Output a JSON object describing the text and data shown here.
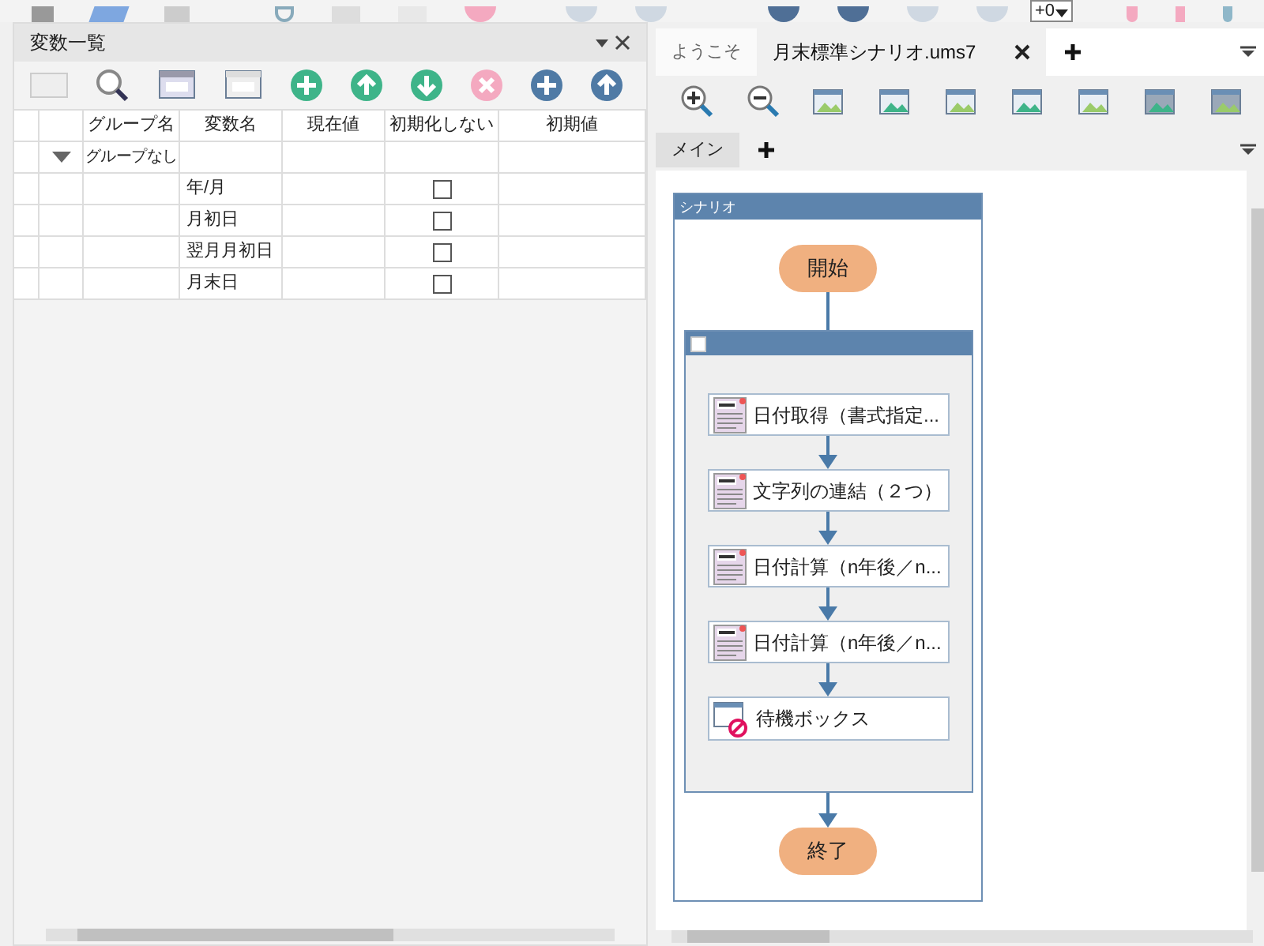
{
  "top_toolbar": {
    "spinner_value": "+0"
  },
  "variables_panel": {
    "title": "変数一覧",
    "columns": [
      "グループ名",
      "変数名",
      "現在値",
      "初期化しない",
      "初期値"
    ],
    "groups": [
      {
        "name": "グループなし",
        "expanded": true,
        "variables": [
          {
            "name": "年/月",
            "no_init": false
          },
          {
            "name": "月初日",
            "no_init": false
          },
          {
            "name": "翌月月初日",
            "no_init": false
          },
          {
            "name": "月末日",
            "no_init": false
          }
        ]
      }
    ]
  },
  "editor": {
    "tabs": [
      {
        "label": "ようこそ",
        "selected": false
      },
      {
        "label": "月末標準シナリオ.ums7",
        "selected": true
      }
    ],
    "sub_tabs": [
      {
        "label": "メイン",
        "selected": true
      }
    ],
    "scenario": {
      "title": "シナリオ",
      "start": "開始",
      "end": "終了",
      "steps": [
        {
          "kind": "script",
          "label": "日付取得（書式指定..."
        },
        {
          "kind": "script",
          "label": "文字列の連結（２つ）"
        },
        {
          "kind": "script",
          "label": "日付計算（n年後／n..."
        },
        {
          "kind": "script",
          "label": "日付計算（n年後／n..."
        },
        {
          "kind": "wait",
          "label": "待機ボックス"
        }
      ]
    }
  }
}
